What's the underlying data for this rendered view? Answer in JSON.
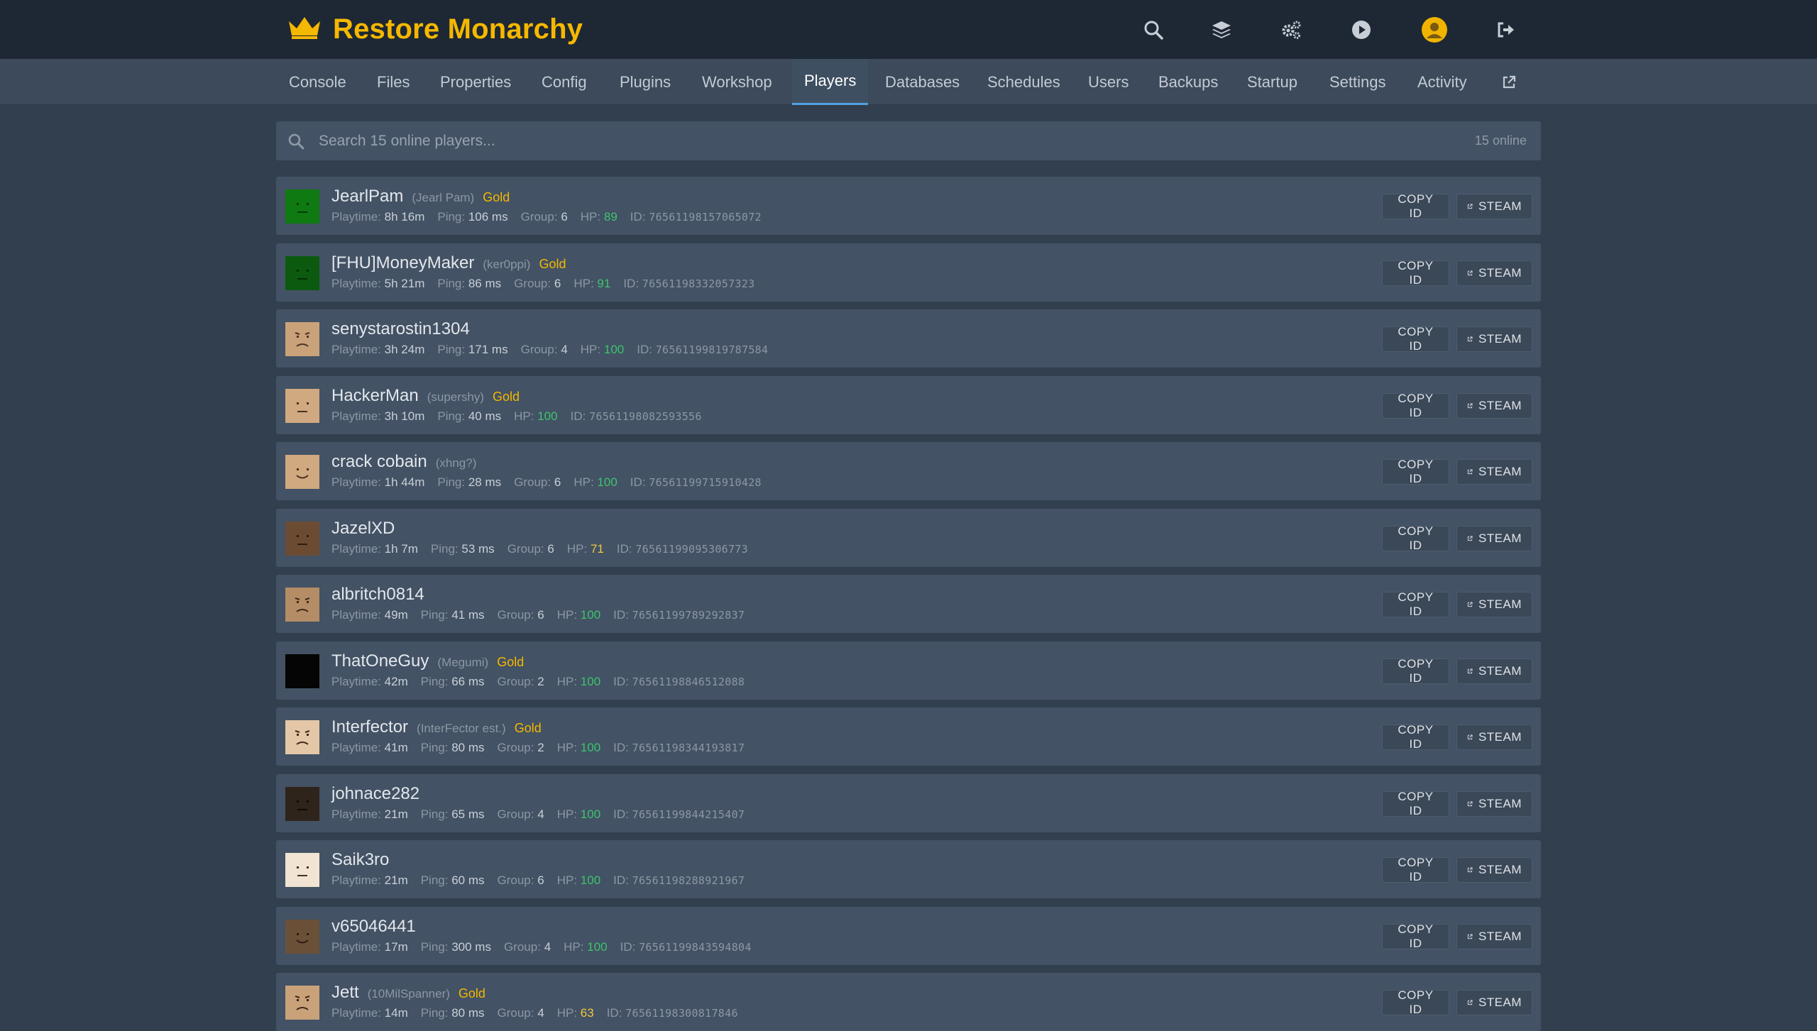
{
  "app": {
    "title": "Restore Monarchy",
    "brand_color": "#f5b800",
    "top_icons": [
      "search-icon",
      "layers-icon",
      "cogs-icon",
      "play-icon",
      "user-avatar",
      "logout-icon"
    ]
  },
  "nav": {
    "tabs": [
      {
        "label": "Console"
      },
      {
        "label": "Files"
      },
      {
        "label": "Properties"
      },
      {
        "label": "Config"
      },
      {
        "label": "Plugins"
      },
      {
        "label": "Workshop"
      },
      {
        "label": "Players",
        "active": true
      },
      {
        "label": "Databases"
      },
      {
        "label": "Schedules"
      },
      {
        "label": "Users"
      },
      {
        "label": "Backups"
      },
      {
        "label": "Startup"
      },
      {
        "label": "Settings"
      },
      {
        "label": "Activity"
      }
    ],
    "external_icon": "external-link-icon"
  },
  "search": {
    "placeholder": "Search 15 online players...",
    "online_count": "15 online"
  },
  "labels": {
    "playtime": "Playtime:",
    "ping": "Ping:",
    "group": "Group:",
    "hp": "HP:",
    "id": "ID:",
    "copy_id": "COPY ID",
    "steam": "STEAM"
  },
  "players": [
    {
      "name": "JearlPam",
      "nick": "(Jearl Pam)",
      "badge": "Gold",
      "playtime": "8h 16m",
      "ping": "106 ms",
      "group": "6",
      "hp": "89",
      "id": "76561198157065072",
      "avatar": {
        "bg": "#0f7a12",
        "fg": "#043b06",
        "mouth": "flat"
      }
    },
    {
      "name": "[FHU]MoneyMaker",
      "nick": "(ker0ppi)",
      "badge": "Gold",
      "playtime": "5h 21m",
      "ping": "86 ms",
      "group": "6",
      "hp": "91",
      "id": "76561198332057323",
      "avatar": {
        "bg": "#0b5a10",
        "fg": "#032e05",
        "mouth": "flat"
      }
    },
    {
      "name": "senystarostin1304",
      "nick": "",
      "badge": "",
      "playtime": "3h 24m",
      "ping": "171 ms",
      "group": "4",
      "hp": "100",
      "id": "76561199819787584",
      "avatar": {
        "bg": "#c9a27a",
        "fg": "#4a3420",
        "mouth": "frown"
      }
    },
    {
      "name": "HackerMan",
      "nick": "(supershy)",
      "badge": "Gold",
      "playtime": "3h 10m",
      "ping": "40 ms",
      "group": "",
      "hp": "100",
      "id": "76561198082593556",
      "avatar": {
        "bg": "#d0a980",
        "fg": "#4a3420",
        "mouth": "flat"
      }
    },
    {
      "name": "crack cobain",
      "nick": "(xhng?)",
      "badge": "",
      "playtime": "1h 44m",
      "ping": "28 ms",
      "group": "6",
      "hp": "100",
      "id": "76561199715910428",
      "avatar": {
        "bg": "#d0a980",
        "fg": "#4a3420",
        "mouth": "smile"
      }
    },
    {
      "name": "JazelXD",
      "nick": "",
      "badge": "",
      "playtime": "1h 7m",
      "ping": "53 ms",
      "group": "6",
      "hp": "71",
      "id": "76561199095306773",
      "avatar": {
        "bg": "#6b4c33",
        "fg": "#2c1d10",
        "mouth": "flat"
      }
    },
    {
      "name": "albritch0814",
      "nick": "",
      "badge": "",
      "playtime": "49m",
      "ping": "41 ms",
      "group": "6",
      "hp": "100",
      "id": "76561199789292837",
      "avatar": {
        "bg": "#b48d66",
        "fg": "#3e2a18",
        "mouth": "frown"
      }
    },
    {
      "name": "ThatOneGuy",
      "nick": "(Megumi)",
      "badge": "Gold",
      "playtime": "42m",
      "ping": "66 ms",
      "group": "2",
      "hp": "100",
      "id": "76561198846512088",
      "avatar": {
        "bg": "#050505",
        "fg": "#050505",
        "mouth": "none"
      }
    },
    {
      "name": "Interfector",
      "nick": "(InterFector est.)",
      "badge": "Gold",
      "playtime": "41m",
      "ping": "80 ms",
      "group": "2",
      "hp": "100",
      "id": "76561198344193817",
      "avatar": {
        "bg": "#e3c7a6",
        "fg": "#3e2a18",
        "mouth": "frown"
      }
    },
    {
      "name": "johnace282",
      "nick": "",
      "badge": "",
      "playtime": "21m",
      "ping": "65 ms",
      "group": "4",
      "hp": "100",
      "id": "76561199844215407",
      "avatar": {
        "bg": "#2e241c",
        "fg": "#0e0a07",
        "mouth": "flat"
      }
    },
    {
      "name": "Saik3ro",
      "nick": "",
      "badge": "",
      "playtime": "21m",
      "ping": "60 ms",
      "group": "6",
      "hp": "100",
      "id": "76561198288921967",
      "avatar": {
        "bg": "#f2e4d2",
        "fg": "#4a3420",
        "mouth": "flat"
      }
    },
    {
      "name": "v65046441",
      "nick": "",
      "badge": "",
      "playtime": "17m",
      "ping": "300 ms",
      "group": "4",
      "hp": "100",
      "id": "76561199843594804",
      "avatar": {
        "bg": "#6b5038",
        "fg": "#2c1d10",
        "mouth": "smile"
      }
    },
    {
      "name": "Jett",
      "nick": "(10MilSpanner)",
      "badge": "Gold",
      "playtime": "14m",
      "ping": "80 ms",
      "group": "4",
      "hp": "63",
      "id": "76561198300817846",
      "avatar": {
        "bg": "#c9a27a",
        "fg": "#3e2a18",
        "mouth": "frown"
      }
    }
  ]
}
